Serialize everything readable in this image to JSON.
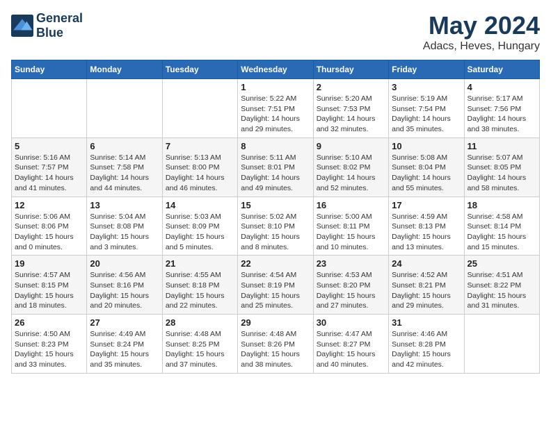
{
  "header": {
    "logo_line1": "General",
    "logo_line2": "Blue",
    "title": "May 2024",
    "subtitle": "Adacs, Heves, Hungary"
  },
  "weekdays": [
    "Sunday",
    "Monday",
    "Tuesday",
    "Wednesday",
    "Thursday",
    "Friday",
    "Saturday"
  ],
  "weeks": [
    [
      {
        "day": "",
        "info": ""
      },
      {
        "day": "",
        "info": ""
      },
      {
        "day": "",
        "info": ""
      },
      {
        "day": "1",
        "info": "Sunrise: 5:22 AM\nSunset: 7:51 PM\nDaylight: 14 hours and 29 minutes."
      },
      {
        "day": "2",
        "info": "Sunrise: 5:20 AM\nSunset: 7:53 PM\nDaylight: 14 hours and 32 minutes."
      },
      {
        "day": "3",
        "info": "Sunrise: 5:19 AM\nSunset: 7:54 PM\nDaylight: 14 hours and 35 minutes."
      },
      {
        "day": "4",
        "info": "Sunrise: 5:17 AM\nSunset: 7:56 PM\nDaylight: 14 hours and 38 minutes."
      }
    ],
    [
      {
        "day": "5",
        "info": "Sunrise: 5:16 AM\nSunset: 7:57 PM\nDaylight: 14 hours and 41 minutes."
      },
      {
        "day": "6",
        "info": "Sunrise: 5:14 AM\nSunset: 7:58 PM\nDaylight: 14 hours and 44 minutes."
      },
      {
        "day": "7",
        "info": "Sunrise: 5:13 AM\nSunset: 8:00 PM\nDaylight: 14 hours and 46 minutes."
      },
      {
        "day": "8",
        "info": "Sunrise: 5:11 AM\nSunset: 8:01 PM\nDaylight: 14 hours and 49 minutes."
      },
      {
        "day": "9",
        "info": "Sunrise: 5:10 AM\nSunset: 8:02 PM\nDaylight: 14 hours and 52 minutes."
      },
      {
        "day": "10",
        "info": "Sunrise: 5:08 AM\nSunset: 8:04 PM\nDaylight: 14 hours and 55 minutes."
      },
      {
        "day": "11",
        "info": "Sunrise: 5:07 AM\nSunset: 8:05 PM\nDaylight: 14 hours and 58 minutes."
      }
    ],
    [
      {
        "day": "12",
        "info": "Sunrise: 5:06 AM\nSunset: 8:06 PM\nDaylight: 15 hours and 0 minutes."
      },
      {
        "day": "13",
        "info": "Sunrise: 5:04 AM\nSunset: 8:08 PM\nDaylight: 15 hours and 3 minutes."
      },
      {
        "day": "14",
        "info": "Sunrise: 5:03 AM\nSunset: 8:09 PM\nDaylight: 15 hours and 5 minutes."
      },
      {
        "day": "15",
        "info": "Sunrise: 5:02 AM\nSunset: 8:10 PM\nDaylight: 15 hours and 8 minutes."
      },
      {
        "day": "16",
        "info": "Sunrise: 5:00 AM\nSunset: 8:11 PM\nDaylight: 15 hours and 10 minutes."
      },
      {
        "day": "17",
        "info": "Sunrise: 4:59 AM\nSunset: 8:13 PM\nDaylight: 15 hours and 13 minutes."
      },
      {
        "day": "18",
        "info": "Sunrise: 4:58 AM\nSunset: 8:14 PM\nDaylight: 15 hours and 15 minutes."
      }
    ],
    [
      {
        "day": "19",
        "info": "Sunrise: 4:57 AM\nSunset: 8:15 PM\nDaylight: 15 hours and 18 minutes."
      },
      {
        "day": "20",
        "info": "Sunrise: 4:56 AM\nSunset: 8:16 PM\nDaylight: 15 hours and 20 minutes."
      },
      {
        "day": "21",
        "info": "Sunrise: 4:55 AM\nSunset: 8:18 PM\nDaylight: 15 hours and 22 minutes."
      },
      {
        "day": "22",
        "info": "Sunrise: 4:54 AM\nSunset: 8:19 PM\nDaylight: 15 hours and 25 minutes."
      },
      {
        "day": "23",
        "info": "Sunrise: 4:53 AM\nSunset: 8:20 PM\nDaylight: 15 hours and 27 minutes."
      },
      {
        "day": "24",
        "info": "Sunrise: 4:52 AM\nSunset: 8:21 PM\nDaylight: 15 hours and 29 minutes."
      },
      {
        "day": "25",
        "info": "Sunrise: 4:51 AM\nSunset: 8:22 PM\nDaylight: 15 hours and 31 minutes."
      }
    ],
    [
      {
        "day": "26",
        "info": "Sunrise: 4:50 AM\nSunset: 8:23 PM\nDaylight: 15 hours and 33 minutes."
      },
      {
        "day": "27",
        "info": "Sunrise: 4:49 AM\nSunset: 8:24 PM\nDaylight: 15 hours and 35 minutes."
      },
      {
        "day": "28",
        "info": "Sunrise: 4:48 AM\nSunset: 8:25 PM\nDaylight: 15 hours and 37 minutes."
      },
      {
        "day": "29",
        "info": "Sunrise: 4:48 AM\nSunset: 8:26 PM\nDaylight: 15 hours and 38 minutes."
      },
      {
        "day": "30",
        "info": "Sunrise: 4:47 AM\nSunset: 8:27 PM\nDaylight: 15 hours and 40 minutes."
      },
      {
        "day": "31",
        "info": "Sunrise: 4:46 AM\nSunset: 8:28 PM\nDaylight: 15 hours and 42 minutes."
      },
      {
        "day": "",
        "info": ""
      }
    ]
  ]
}
